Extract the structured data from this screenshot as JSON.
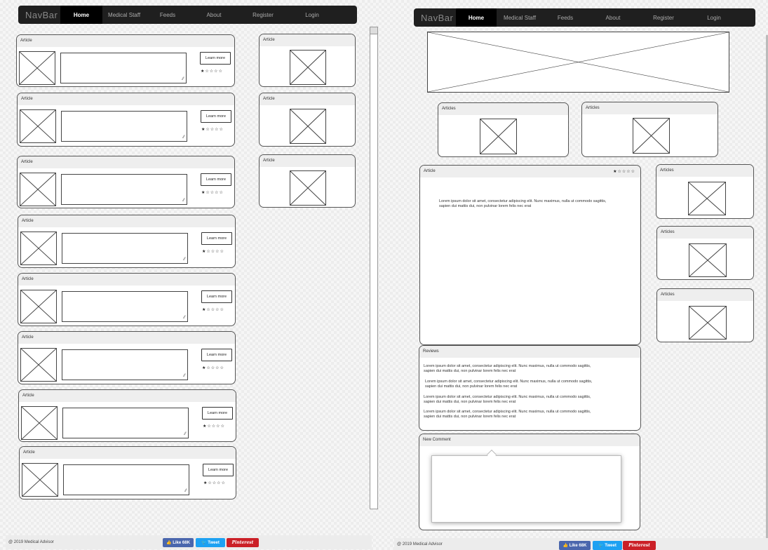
{
  "navbar": {
    "brand": "NavBar",
    "items": [
      "Home",
      "Medical Staff",
      "Feeds",
      "About",
      "Register",
      "Login"
    ]
  },
  "left": {
    "article_label": "Article",
    "learn_more": "Learn more",
    "rating": "★☆☆☆☆",
    "side_label": "Article"
  },
  "right": {
    "articles_label": "Articles",
    "article_label": "Article",
    "rating": "★☆☆☆☆",
    "body_text": "Lorem ipsum dolor sit amet, consectetur adipiscing elit. Nunc maximus, nulla ut commodo sagittis, sapien dui mattis dui, non pulvinar lorem felis nec erat",
    "reviews_title": "Reviews",
    "reviews": [
      "Lorem ipsum dolor sit amet, consectetur adipiscing elit. Nunc maximus, nulla ut commodo sagittis, sapien dui mattis dui, non pulvinar lorem felis nec erat",
      "Lorem ipsum dolor sit amet, consectetur adipiscing elit. Nunc maximus, nulla ut commodo sagittis, sapien dui mattis dui, non pulvinar lorem felis nec erat",
      "Lorem ipsum dolor sit amet, consectetur adipiscing elit. Nunc maximus, nulla ut commodo sagittis, sapien dui mattis dui, non pulvinar lorem felis nec erat",
      "Lorem ipsum dolor sit amet, consectetur adipiscing elit. Nunc maximus, nulla ut commodo sagittis, sapien dui mattis dui, non pulvinar lorem felis nec erat"
    ],
    "new_comment": "New Comment"
  },
  "footer": {
    "copyright": "@ 2019 Medical Advisor",
    "like": "👍 Like 68K",
    "tweet": "🐦 Tweet",
    "pinterest": "Pinterest"
  },
  "colors": {
    "facebook": "#4a66ad",
    "twitter": "#1da1f2",
    "pinterest": "#cb2027"
  }
}
